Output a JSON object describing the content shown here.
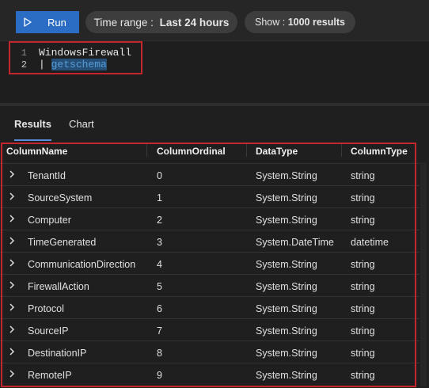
{
  "toolbar": {
    "run_label": "Run",
    "time_range_label": "Time range :",
    "time_range_value": "Last 24 hours",
    "show_label": "Show :",
    "show_value": "1000 results",
    "accent_color": "#2b6cc4"
  },
  "editor": {
    "lines": [
      {
        "number": "1",
        "text": "WindowsFirewall"
      },
      {
        "number": "2",
        "pipe": "| ",
        "text": "getschema"
      }
    ]
  },
  "tabs": [
    {
      "label": "Results",
      "active": true
    },
    {
      "label": "Chart",
      "active": false
    }
  ],
  "table": {
    "columns": [
      "ColumnName",
      "ColumnOrdinal",
      "DataType",
      "ColumnType"
    ],
    "rows": [
      {
        "name": "TenantId",
        "ordinal": "0",
        "datatype": "System.String",
        "coltype": "string"
      },
      {
        "name": "SourceSystem",
        "ordinal": "1",
        "datatype": "System.String",
        "coltype": "string"
      },
      {
        "name": "Computer",
        "ordinal": "2",
        "datatype": "System.String",
        "coltype": "string"
      },
      {
        "name": "TimeGenerated",
        "ordinal": "3",
        "datatype": "System.DateTime",
        "coltype": "datetime"
      },
      {
        "name": "CommunicationDirection",
        "ordinal": "4",
        "datatype": "System.String",
        "coltype": "string"
      },
      {
        "name": "FirewallAction",
        "ordinal": "5",
        "datatype": "System.String",
        "coltype": "string"
      },
      {
        "name": "Protocol",
        "ordinal": "6",
        "datatype": "System.String",
        "coltype": "string"
      },
      {
        "name": "SourceIP",
        "ordinal": "7",
        "datatype": "System.String",
        "coltype": "string"
      },
      {
        "name": "DestinationIP",
        "ordinal": "8",
        "datatype": "System.String",
        "coltype": "string"
      },
      {
        "name": "RemoteIP",
        "ordinal": "9",
        "datatype": "System.String",
        "coltype": "string"
      }
    ]
  },
  "highlight_color": "#c4262e"
}
